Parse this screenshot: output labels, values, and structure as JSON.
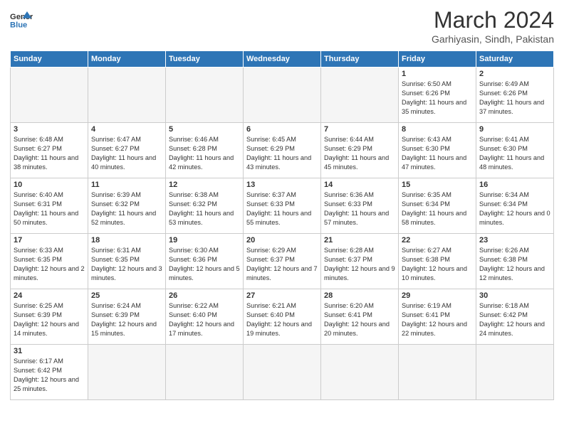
{
  "logo": {
    "text_general": "General",
    "text_blue": "Blue"
  },
  "title": {
    "month_year": "March 2024",
    "location": "Garhiyasin, Sindh, Pakistan"
  },
  "days_of_week": [
    "Sunday",
    "Monday",
    "Tuesday",
    "Wednesday",
    "Thursday",
    "Friday",
    "Saturday"
  ],
  "weeks": [
    [
      {
        "day": "",
        "empty": true
      },
      {
        "day": "",
        "empty": true
      },
      {
        "day": "",
        "empty": true
      },
      {
        "day": "",
        "empty": true
      },
      {
        "day": "",
        "empty": true
      },
      {
        "day": "1",
        "sunrise": "6:50 AM",
        "sunset": "6:26 PM",
        "daylight": "11 hours and 35 minutes."
      },
      {
        "day": "2",
        "sunrise": "6:49 AM",
        "sunset": "6:26 PM",
        "daylight": "11 hours and 37 minutes."
      }
    ],
    [
      {
        "day": "3",
        "sunrise": "6:48 AM",
        "sunset": "6:27 PM",
        "daylight": "11 hours and 38 minutes."
      },
      {
        "day": "4",
        "sunrise": "6:47 AM",
        "sunset": "6:27 PM",
        "daylight": "11 hours and 40 minutes."
      },
      {
        "day": "5",
        "sunrise": "6:46 AM",
        "sunset": "6:28 PM",
        "daylight": "11 hours and 42 minutes."
      },
      {
        "day": "6",
        "sunrise": "6:45 AM",
        "sunset": "6:29 PM",
        "daylight": "11 hours and 43 minutes."
      },
      {
        "day": "7",
        "sunrise": "6:44 AM",
        "sunset": "6:29 PM",
        "daylight": "11 hours and 45 minutes."
      },
      {
        "day": "8",
        "sunrise": "6:43 AM",
        "sunset": "6:30 PM",
        "daylight": "11 hours and 47 minutes."
      },
      {
        "day": "9",
        "sunrise": "6:41 AM",
        "sunset": "6:30 PM",
        "daylight": "11 hours and 48 minutes."
      }
    ],
    [
      {
        "day": "10",
        "sunrise": "6:40 AM",
        "sunset": "6:31 PM",
        "daylight": "11 hours and 50 minutes."
      },
      {
        "day": "11",
        "sunrise": "6:39 AM",
        "sunset": "6:32 PM",
        "daylight": "11 hours and 52 minutes."
      },
      {
        "day": "12",
        "sunrise": "6:38 AM",
        "sunset": "6:32 PM",
        "daylight": "11 hours and 53 minutes."
      },
      {
        "day": "13",
        "sunrise": "6:37 AM",
        "sunset": "6:33 PM",
        "daylight": "11 hours and 55 minutes."
      },
      {
        "day": "14",
        "sunrise": "6:36 AM",
        "sunset": "6:33 PM",
        "daylight": "11 hours and 57 minutes."
      },
      {
        "day": "15",
        "sunrise": "6:35 AM",
        "sunset": "6:34 PM",
        "daylight": "11 hours and 58 minutes."
      },
      {
        "day": "16",
        "sunrise": "6:34 AM",
        "sunset": "6:34 PM",
        "daylight": "12 hours and 0 minutes."
      }
    ],
    [
      {
        "day": "17",
        "sunrise": "6:33 AM",
        "sunset": "6:35 PM",
        "daylight": "12 hours and 2 minutes."
      },
      {
        "day": "18",
        "sunrise": "6:31 AM",
        "sunset": "6:35 PM",
        "daylight": "12 hours and 3 minutes."
      },
      {
        "day": "19",
        "sunrise": "6:30 AM",
        "sunset": "6:36 PM",
        "daylight": "12 hours and 5 minutes."
      },
      {
        "day": "20",
        "sunrise": "6:29 AM",
        "sunset": "6:37 PM",
        "daylight": "12 hours and 7 minutes."
      },
      {
        "day": "21",
        "sunrise": "6:28 AM",
        "sunset": "6:37 PM",
        "daylight": "12 hours and 9 minutes."
      },
      {
        "day": "22",
        "sunrise": "6:27 AM",
        "sunset": "6:38 PM",
        "daylight": "12 hours and 10 minutes."
      },
      {
        "day": "23",
        "sunrise": "6:26 AM",
        "sunset": "6:38 PM",
        "daylight": "12 hours and 12 minutes."
      }
    ],
    [
      {
        "day": "24",
        "sunrise": "6:25 AM",
        "sunset": "6:39 PM",
        "daylight": "12 hours and 14 minutes."
      },
      {
        "day": "25",
        "sunrise": "6:24 AM",
        "sunset": "6:39 PM",
        "daylight": "12 hours and 15 minutes."
      },
      {
        "day": "26",
        "sunrise": "6:22 AM",
        "sunset": "6:40 PM",
        "daylight": "12 hours and 17 minutes."
      },
      {
        "day": "27",
        "sunrise": "6:21 AM",
        "sunset": "6:40 PM",
        "daylight": "12 hours and 19 minutes."
      },
      {
        "day": "28",
        "sunrise": "6:20 AM",
        "sunset": "6:41 PM",
        "daylight": "12 hours and 20 minutes."
      },
      {
        "day": "29",
        "sunrise": "6:19 AM",
        "sunset": "6:41 PM",
        "daylight": "12 hours and 22 minutes."
      },
      {
        "day": "30",
        "sunrise": "6:18 AM",
        "sunset": "6:42 PM",
        "daylight": "12 hours and 24 minutes."
      }
    ],
    [
      {
        "day": "31",
        "sunrise": "6:17 AM",
        "sunset": "6:42 PM",
        "daylight": "12 hours and 25 minutes."
      },
      {
        "day": "",
        "empty": true
      },
      {
        "day": "",
        "empty": true
      },
      {
        "day": "",
        "empty": true
      },
      {
        "day": "",
        "empty": true
      },
      {
        "day": "",
        "empty": true
      },
      {
        "day": "",
        "empty": true
      }
    ]
  ]
}
